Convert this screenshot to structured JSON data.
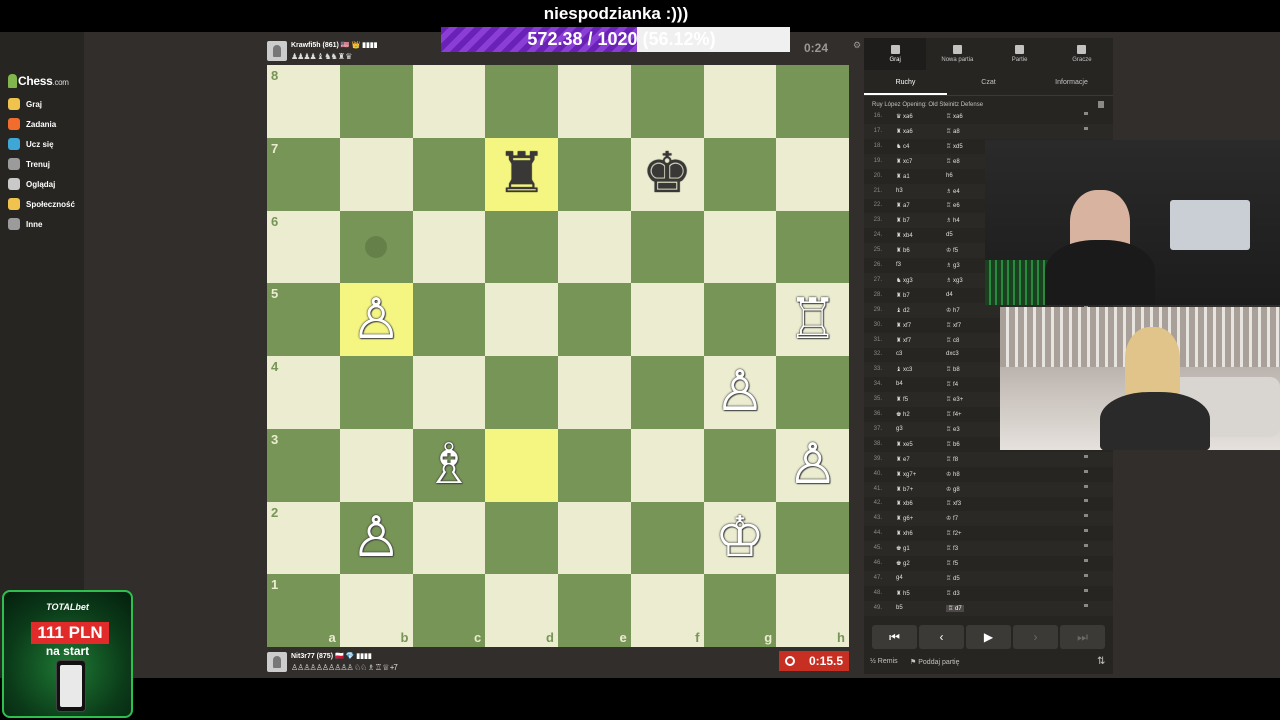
{
  "stream": {
    "title": "niespodzianka :)))",
    "progress_text": "572.38 / 1020 (56.12%)",
    "progress_fraction": 0.5612
  },
  "sidebar": {
    "logo_text": "Chess",
    "logo_suffix": ".com",
    "items": [
      {
        "label": "Graj",
        "icon": "play-icon",
        "color": "#f0c34e"
      },
      {
        "label": "Zadania",
        "icon": "puzzle-icon",
        "color": "#f26d2d"
      },
      {
        "label": "Ucz się",
        "icon": "learn-icon",
        "color": "#3fa7d6"
      },
      {
        "label": "Trenuj",
        "icon": "train-icon",
        "color": "#9b9b9b"
      },
      {
        "label": "Oglądaj",
        "icon": "watch-icon",
        "color": "#c9c9c9"
      },
      {
        "label": "Społeczność",
        "icon": "community-icon",
        "color": "#f0c34e"
      },
      {
        "label": "Inne",
        "icon": "more-icon",
        "color": "#9b9b9b"
      }
    ]
  },
  "players": {
    "top": {
      "name": "Krawfi5h (861) 🇺🇸 👑 ▮▮▮▮",
      "captured": "♟♟♟♟ ♝ ♞♞ ♜ ♛",
      "clock": "0:24"
    },
    "bottom": {
      "name": "Nit3r77 (875) 🇵🇱 💎 ▮▮▮▮",
      "captured": "♙♙♙♙♙♙♙♙♙♙ ♘♘ ♗ ♖ ♕ +7",
      "clock": "0:15.5"
    }
  },
  "board": {
    "files": [
      "a",
      "b",
      "c",
      "d",
      "e",
      "f",
      "g",
      "h"
    ],
    "ranks": [
      "8",
      "7",
      "6",
      "5",
      "4",
      "3",
      "2",
      "1"
    ],
    "light_color": "#ebecd0",
    "dark_color": "#779556",
    "highlight_light": "#f5f682",
    "highlight_dark": "#b9ca43",
    "highlights": [
      "d7",
      "b5",
      "d3"
    ],
    "hints": [
      "b6"
    ],
    "pieces": [
      {
        "sq": "d7",
        "piece": "♜",
        "color": "b",
        "name": "black-rook"
      },
      {
        "sq": "f7",
        "piece": "♚",
        "color": "b",
        "name": "black-king"
      },
      {
        "sq": "b5",
        "piece": "♙",
        "color": "w",
        "name": "white-pawn"
      },
      {
        "sq": "h5",
        "piece": "♖",
        "color": "w",
        "name": "white-rook"
      },
      {
        "sq": "g4",
        "piece": "♙",
        "color": "w",
        "name": "white-pawn"
      },
      {
        "sq": "c3",
        "piece": "♗",
        "color": "w",
        "name": "white-bishop"
      },
      {
        "sq": "h3",
        "piece": "♙",
        "color": "w",
        "name": "white-pawn"
      },
      {
        "sq": "b2",
        "piece": "♙",
        "color": "w",
        "name": "white-pawn"
      },
      {
        "sq": "g2",
        "piece": "♔",
        "color": "w",
        "name": "white-king"
      }
    ]
  },
  "panel": {
    "tabs": [
      {
        "label": "Graj",
        "active": true
      },
      {
        "label": "Nowa partia",
        "active": false
      },
      {
        "label": "Partie",
        "active": false
      },
      {
        "label": "Gracze",
        "active": false
      }
    ],
    "subtabs": [
      {
        "label": "Ruchy",
        "active": true
      },
      {
        "label": "Czat",
        "active": false
      },
      {
        "label": "Informacje",
        "active": false
      }
    ],
    "opening": "Ruy López Opening: Old Steinitz Defense",
    "moves": [
      {
        "n": "16.",
        "w": "♛ xa6",
        "b": "♖ xa6"
      },
      {
        "n": "17.",
        "w": "♜ xa6",
        "b": "♖ a8"
      },
      {
        "n": "18.",
        "w": "♞ c4",
        "b": "♖ xd5"
      },
      {
        "n": "19.",
        "w": "♜ xc7",
        "b": "♖ e8"
      },
      {
        "n": "20.",
        "w": "♜ a1",
        "b": "h6"
      },
      {
        "n": "21.",
        "w": "h3",
        "b": "♗ e4"
      },
      {
        "n": "22.",
        "w": "♜ a7",
        "b": "♖ e6"
      },
      {
        "n": "23.",
        "w": "♜ b7",
        "b": "♗ h4"
      },
      {
        "n": "24.",
        "w": "♜ xb4",
        "b": "d5"
      },
      {
        "n": "25.",
        "w": "♜ b6",
        "b": "♔ f5"
      },
      {
        "n": "26.",
        "w": "f3",
        "b": "♗ g3"
      },
      {
        "n": "27.",
        "w": "♞ xg3",
        "b": "♗ xg3"
      },
      {
        "n": "28.",
        "w": "♜ b7",
        "b": "d4"
      },
      {
        "n": "29.",
        "w": "♝ d2",
        "b": "♔ h7"
      },
      {
        "n": "30.",
        "w": "♜ xf7",
        "b": "♖ xf7"
      },
      {
        "n": "31.",
        "w": "♜ xf7",
        "b": "♖ c8"
      },
      {
        "n": "32.",
        "w": "c3",
        "b": "dxc3"
      },
      {
        "n": "33.",
        "w": "♝ xc3",
        "b": "♖ b8"
      },
      {
        "n": "34.",
        "w": "b4",
        "b": "♖ f4"
      },
      {
        "n": "35.",
        "w": "♜ f5",
        "b": "♖ e3+"
      },
      {
        "n": "36.",
        "w": "♚ h2",
        "b": "♖ f4+"
      },
      {
        "n": "37.",
        "w": "g3",
        "b": "♖ e3"
      },
      {
        "n": "38.",
        "w": "♜ xe5",
        "b": "♖ b6"
      },
      {
        "n": "39.",
        "w": "♜ e7",
        "b": "♖ f8"
      },
      {
        "n": "40.",
        "w": "♜ xg7+",
        "b": "♔ h8"
      },
      {
        "n": "41.",
        "w": "♜ b7+",
        "b": "♔ g8"
      },
      {
        "n": "42.",
        "w": "♜ xb6",
        "b": "♖ xf3"
      },
      {
        "n": "43.",
        "w": "♜ g6+",
        "b": "♔ f7"
      },
      {
        "n": "44.",
        "w": "♜ xh6",
        "b": "♖ f2+"
      },
      {
        "n": "45.",
        "w": "♚ g1",
        "b": "♖ f3"
      },
      {
        "n": "46.",
        "w": "♚ g2",
        "b": "♖ f5"
      },
      {
        "n": "47.",
        "w": "g4",
        "b": "♖ d5"
      },
      {
        "n": "48.",
        "w": "♜ h5",
        "b": "♖ d3"
      },
      {
        "n": "49.",
        "w": "b5",
        "b": "♖ d7"
      }
    ],
    "nav": [
      "⏮",
      "‹",
      "▶",
      "›",
      "⏭"
    ],
    "draw_label": "Remis",
    "resign_label": "Poddaj partię"
  },
  "ad": {
    "brand": "TOTALbet",
    "amount": "111 PLN",
    "sub": "na start"
  }
}
